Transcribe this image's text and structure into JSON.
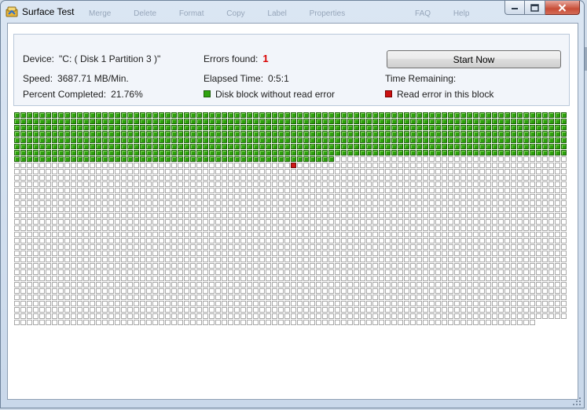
{
  "window": {
    "title": "Surface Test",
    "background_menu": [
      "Merge",
      "Delete",
      "Format",
      "Copy",
      "Label",
      "Properties",
      "FAQ",
      "Help"
    ]
  },
  "caption": {
    "minimize_icon": "minimize-icon",
    "maximize_icon": "maximize-icon",
    "close_icon": "close-icon"
  },
  "info": {
    "device_label": "Device:",
    "device_value": "\"C: ( Disk 1 Partition 3 )\"",
    "speed_label": "Speed:",
    "speed_value": "3687.71 MB/Min.",
    "percent_label": "Percent Completed:",
    "percent_value": "21.76%",
    "errors_label": "Errors found:",
    "errors_value": "1",
    "elapsed_label": "Elapsed Time:",
    "elapsed_value": "0:5:1",
    "remaining_label": "Time Remaining:",
    "remaining_value": "",
    "start_button": "Start Now",
    "legend_good": "Disk block without read error",
    "legend_bad": "Read error in this block"
  },
  "scan_grid": {
    "columns": 88,
    "rows": 34,
    "scanned_blocks": 667,
    "total_blocks": 2987,
    "error_blocks": [
      {
        "row": 8,
        "col": 44
      }
    ]
  },
  "colors": {
    "good_block": "#2da10c",
    "error_block": "#d01818",
    "unscanned_block": "#ffffff",
    "errors_value": "#d90000"
  }
}
